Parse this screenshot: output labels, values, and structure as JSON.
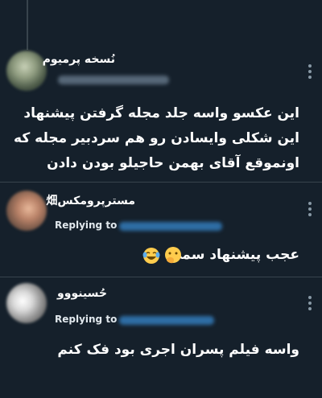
{
  "tweets": [
    {
      "name": "نُسخه پرمیوم",
      "lines": [
        "این عکسو واسه جلد مجله گرفتن پیشنهاد",
        "این شکلی وایسادن رو هم سردبیر مجله که",
        "اونموقع آقای بهمن حاجیلو بودن دادن"
      ]
    },
    {
      "name": "مسترپرومکس畑",
      "replying_label": "Replying to",
      "text": "عجب پیشنهاد سمی",
      "emojis": [
        "laughing-tears-emoji",
        "hand-over-mouth-emoji"
      ]
    },
    {
      "name": "حُسینووو",
      "replying_label": "Replying to",
      "text": "واسه فیلم پسران اجری بود فک کنم"
    }
  ],
  "colors": {
    "background": "#15202b",
    "text": "#ffffff",
    "muted": "#8899a6",
    "link": "#1d9bf0",
    "divider": "#38444d"
  }
}
